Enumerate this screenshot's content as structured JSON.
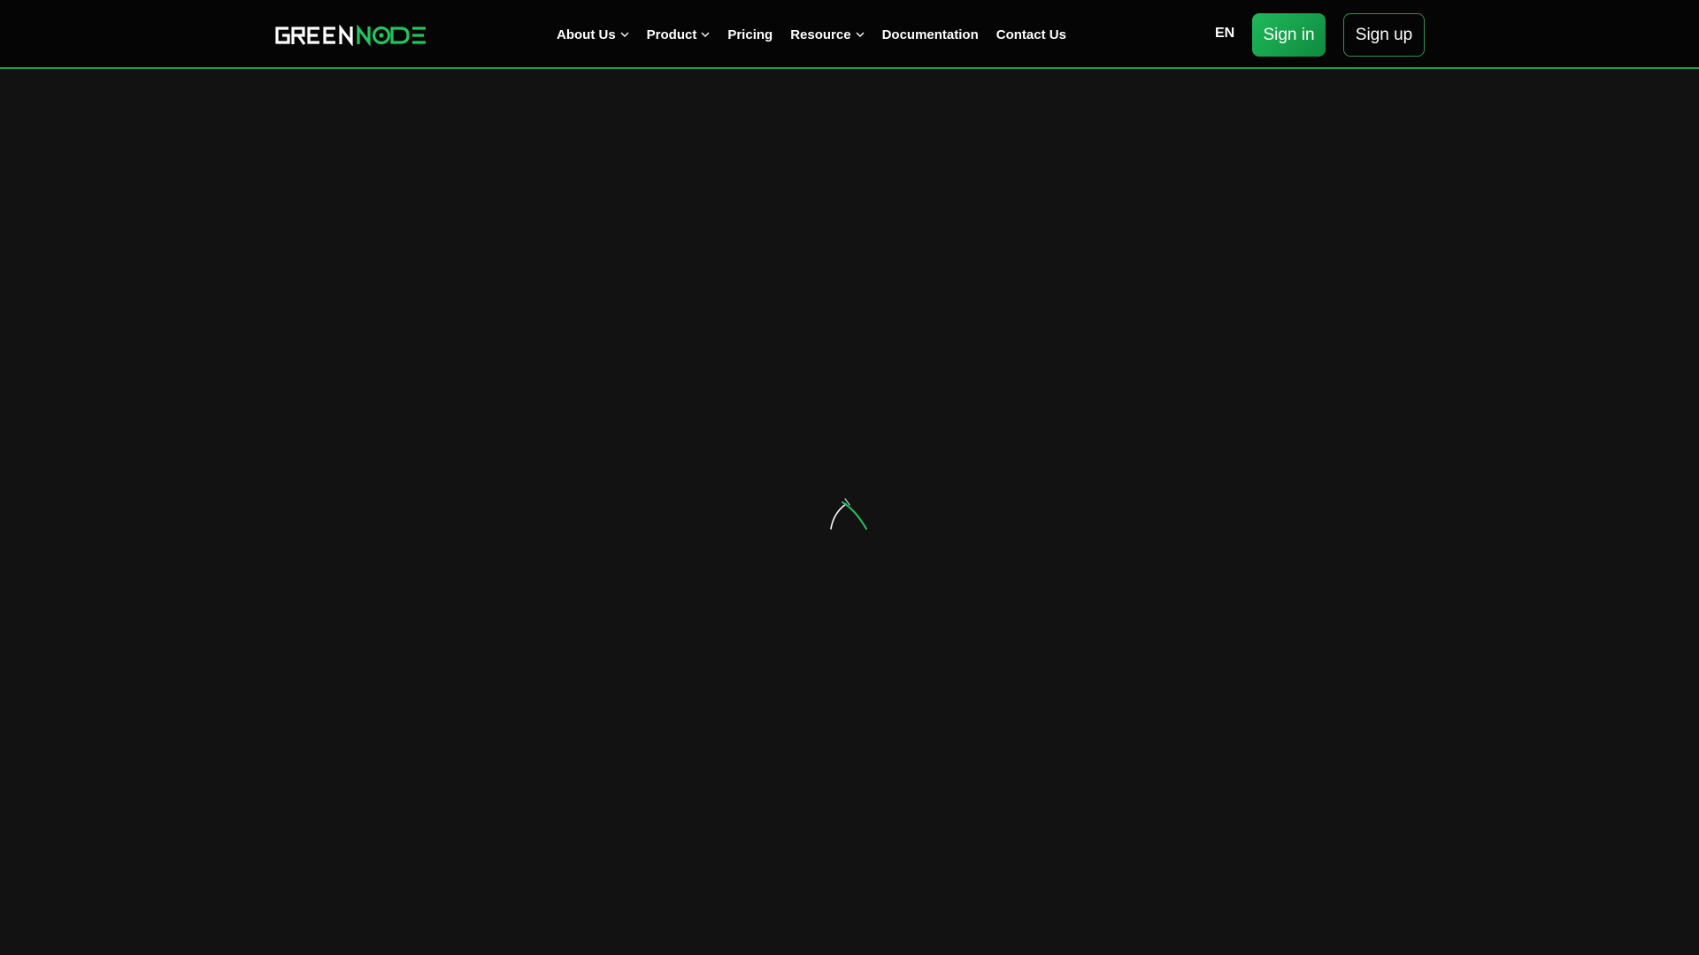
{
  "header": {
    "logo_text": "GREENNODE",
    "nav": [
      {
        "label": "About Us",
        "has_dropdown": true
      },
      {
        "label": "Product",
        "has_dropdown": true
      },
      {
        "label": "Pricing",
        "has_dropdown": false
      },
      {
        "label": "Resource",
        "has_dropdown": true
      },
      {
        "label": "Documentation",
        "has_dropdown": false
      },
      {
        "label": "Contact Us",
        "has_dropdown": false
      }
    ],
    "language": "EN",
    "signin_label": "Sign in",
    "signup_label": "Sign up"
  },
  "main": {
    "loading_icon": "spinner-icon"
  },
  "colors": {
    "brand_green": "#16a34a",
    "header_bg": "#050505",
    "page_bg": "#121212"
  }
}
